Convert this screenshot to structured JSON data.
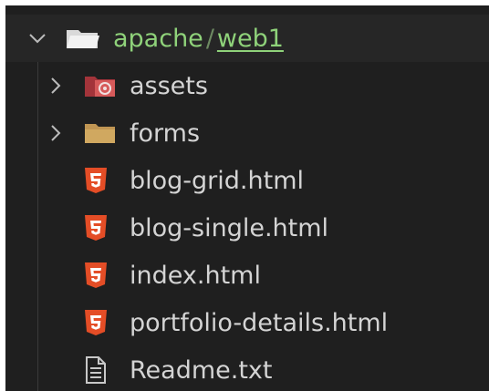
{
  "explorer": {
    "root": {
      "parent": "apache",
      "separator": "/",
      "current": "web1",
      "expanded": true,
      "color": "#8fd27a"
    },
    "items": [
      {
        "label": "assets",
        "kind": "folder",
        "icon": "folder-gear-icon",
        "expanded": false
      },
      {
        "label": "forms",
        "kind": "folder",
        "icon": "folder-icon",
        "expanded": false
      },
      {
        "label": "blog-grid.html",
        "kind": "file",
        "icon": "html5-icon"
      },
      {
        "label": "blog-single.html",
        "kind": "file",
        "icon": "html5-icon"
      },
      {
        "label": "index.html",
        "kind": "file",
        "icon": "html5-icon"
      },
      {
        "label": "portfolio-details.html",
        "kind": "file",
        "icon": "html5-icon"
      },
      {
        "label": "Readme.txt",
        "kind": "file",
        "icon": "text-file-icon"
      }
    ],
    "colors": {
      "background": "#1f1f1f",
      "text": "#d4d4d4",
      "folder": "#c09553",
      "html5": "#e44d26"
    }
  }
}
